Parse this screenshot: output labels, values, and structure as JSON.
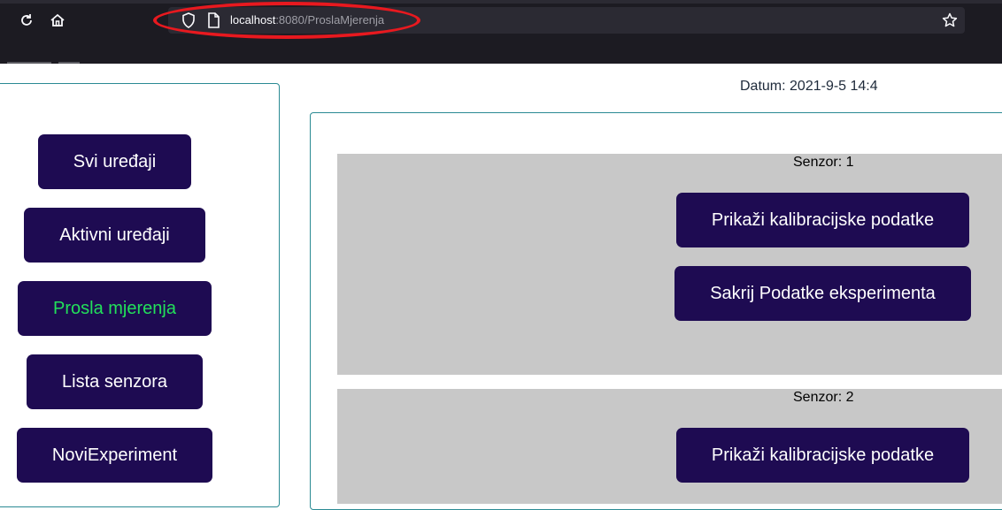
{
  "browser": {
    "url_host": "localhost",
    "url_rest": ":8080/ProslaMjerenja"
  },
  "sidebar": {
    "items": [
      {
        "label": "Svi uređaji"
      },
      {
        "label": "Aktivni uređaji"
      },
      {
        "label": "Prosla mjerenja",
        "active": true
      },
      {
        "label": "Lista senzora"
      },
      {
        "label": "NoviExperiment"
      }
    ]
  },
  "header": {
    "datum": "Datum: 2021-9-5 14:4"
  },
  "sensors": [
    {
      "title": "Senzor: 1",
      "buttons": [
        "Prikaži kalibracijske podatke",
        "Sakrij Podatke eksperimenta"
      ]
    },
    {
      "title": "Senzor: 2",
      "buttons": [
        "Prikaži kalibracijske podatke"
      ]
    }
  ],
  "colors": {
    "button_bg": "#1e0b52",
    "active_text": "#22e05a",
    "card_bg": "#c8c8c8",
    "border": "#2a8a93",
    "annotation": "#e8191f"
  }
}
